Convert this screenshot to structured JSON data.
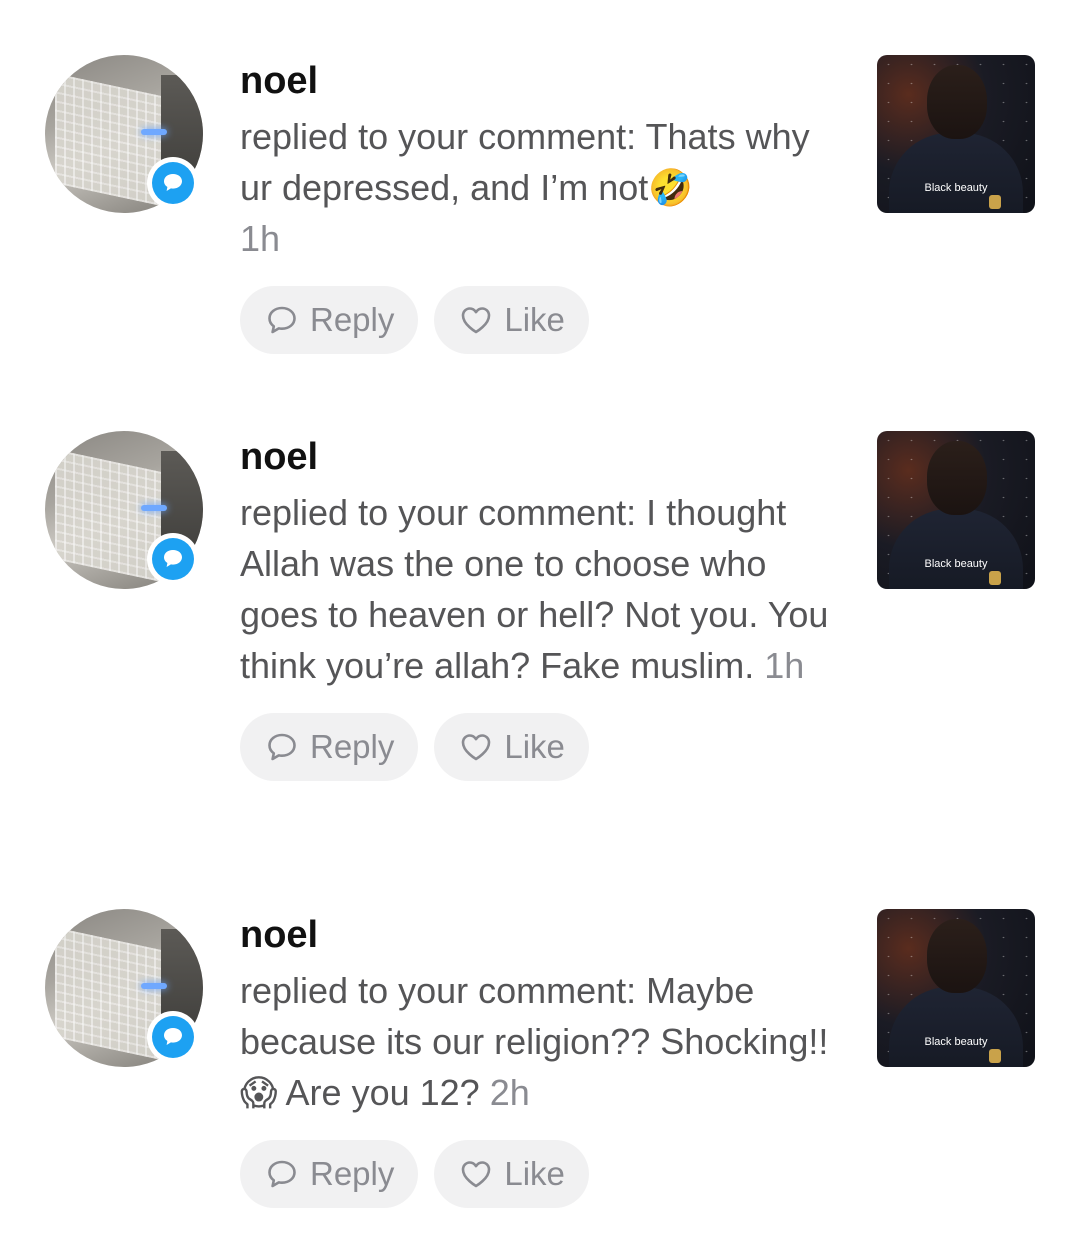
{
  "notifications": [
    {
      "username": "noel",
      "text": "replied to your comment: Thats why ur depressed, and I’m not🤣",
      "time": "1h",
      "reply_label": "Reply",
      "like_label": "Like",
      "thumbnail_caption": "Black beauty"
    },
    {
      "username": "noel",
      "text": "replied to your comment: I thought Allah was the one to choose who goes to heaven or hell? Not you. You think you’re allah? Fake muslim.",
      "time": "1h",
      "reply_label": "Reply",
      "like_label": "Like",
      "thumbnail_caption": "Black beauty"
    },
    {
      "username": "noel",
      "text": "replied to your comment: Maybe because its our religion?? Shocking!! 😱 Are you 12?",
      "time": "2h",
      "reply_label": "Reply",
      "like_label": "Like",
      "thumbnail_caption": "Black beauty"
    }
  ],
  "colors": {
    "badge": "#1da1f2",
    "pill_bg": "#f1f1f2",
    "muted_text": "#8a8b91"
  },
  "icons": {
    "badge": "comment-bubble-icon",
    "reply": "speech-bubble-icon",
    "like": "heart-icon"
  }
}
